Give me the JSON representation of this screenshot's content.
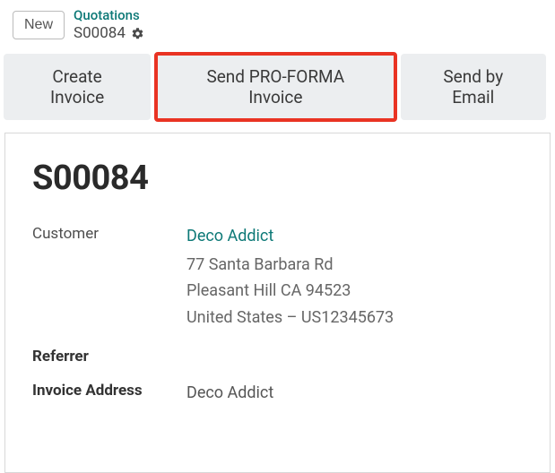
{
  "header": {
    "new_label": "New",
    "breadcrumb_model": "Quotations",
    "record_id": "S00084"
  },
  "actions": {
    "create_invoice": "Create Invoice",
    "send_proforma": "Send PRO-FORMA Invoice",
    "send_email": "Send by Email"
  },
  "form": {
    "title": "S00084",
    "customer_label": "Customer",
    "customer_name": "Deco Addict",
    "address_line1": "77 Santa Barbara Rd",
    "address_line2": "Pleasant Hill CA 94523",
    "address_line3": "United States – US12345673",
    "referrer_label": "Referrer",
    "referrer_value": "",
    "invoice_address_label": "Invoice Address",
    "invoice_address_value": "Deco Addict"
  }
}
